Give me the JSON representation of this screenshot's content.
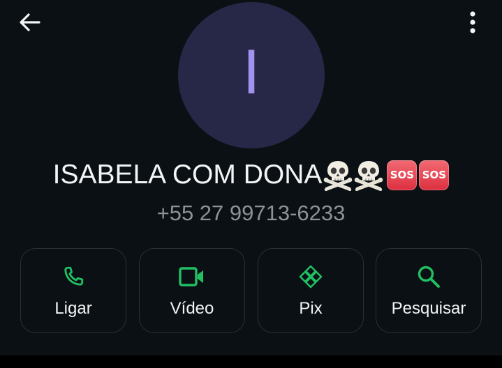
{
  "header": {
    "back_icon": "arrow-left-icon",
    "menu_icon": "more-vertical-icon"
  },
  "contact": {
    "avatar_initial": "I",
    "avatar_bg": "#272747",
    "avatar_fg": "#a192ee",
    "name": "ISABELA COM DONA",
    "name_emojis": [
      "skull-crossbones",
      "skull-crossbones",
      "sos",
      "sos"
    ],
    "sos_label": "SOS",
    "phone": "+55 27 99713-6233"
  },
  "actions": [
    {
      "label": "Ligar",
      "icon": "phone-icon"
    },
    {
      "label": "Vídeo",
      "icon": "video-icon"
    },
    {
      "label": "Pix",
      "icon": "pix-icon"
    },
    {
      "label": "Pesquisar",
      "icon": "search-icon"
    }
  ],
  "colors": {
    "background": "#0b1014",
    "accent": "#21c063",
    "text_primary": "#f2f4f5",
    "text_secondary": "#8b9398",
    "button_border": "#2a3136"
  }
}
